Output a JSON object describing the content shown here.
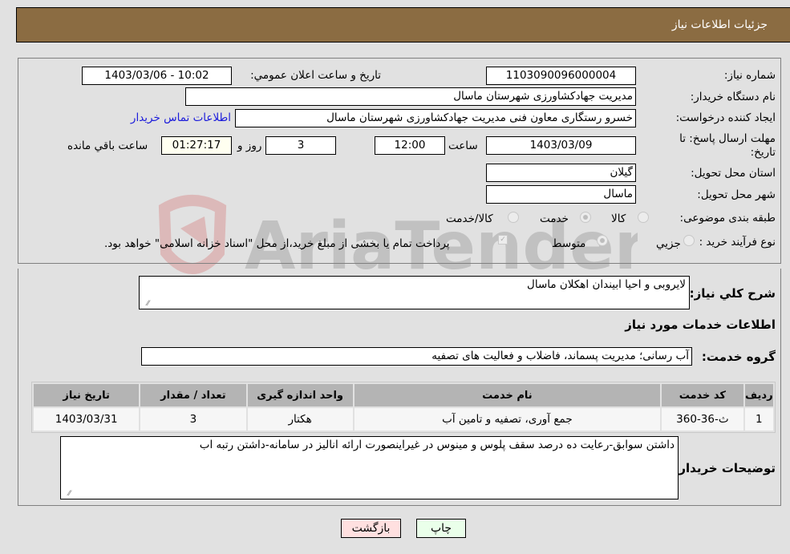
{
  "header": {
    "title": "جزئيات اطلاعات نياز"
  },
  "fields": {
    "need_number": {
      "label": "شماره نياز:",
      "value": "1103090096000004"
    },
    "announce_datetime": {
      "label": "تاريخ و ساعت اعلان عمومي:",
      "value": "1403/03/06 - 10:02"
    },
    "buyer_org": {
      "label": "نام دستگاه خريدار:",
      "value": "مديريت جهادکشاورزی شهرستان ماسال"
    },
    "requester": {
      "label": "ايجاد کننده درخواست:",
      "value": "خسرو  رستگاری معاون فنی مديريت جهادکشاورزی شهرستان ماسال"
    },
    "buyer_contact_link": "اطلاعات تماس خريدار",
    "deadline": {
      "label_line1": "مهلت ارسال پاسخ: تا",
      "label_line2": "تاريخ:",
      "date": "1403/03/09",
      "time_label": "ساعت",
      "time": "12:00",
      "days": "3",
      "days_label": "روز و",
      "remaining": "01:27:17",
      "remaining_label": "ساعت باقي مانده"
    },
    "province": {
      "label": "استان محل تحويل:",
      "value": "گيلان"
    },
    "city": {
      "label": "شهر محل تحويل:",
      "value": "ماسال"
    },
    "category": {
      "label": "طبقه بندی موضوعی:",
      "options": [
        "کالا",
        "خدمت",
        "کالا/خدمت"
      ],
      "selected": "خدمت"
    },
    "purchase_process": {
      "label": "نوع فرآيند خريد :",
      "options": [
        "جزيي",
        "متوسط"
      ],
      "selected": "متوسط",
      "payment_note": "پرداخت تمام يا بخشی از مبلغ خريد،از محل \"اسناد خزانه اسلامی\" خواهد بود."
    }
  },
  "summary": {
    "label": "شرح کلي نياز:",
    "value": "لايروبی و احيا ابيندان اهکلان ماسال"
  },
  "services_section": {
    "title": "اطلاعات خدمات مورد نياز",
    "group_label": "گروه خدمت:",
    "group_value": "آب رسانی؛ مديريت پسماند، فاضلاب و فعاليت های تصفيه"
  },
  "table": {
    "columns": [
      "رديف",
      "کد خدمت",
      "نام خدمت",
      "واحد اندازه گيری",
      "تعداد / مقدار",
      "تاريخ نياز"
    ],
    "rows": [
      [
        "1",
        "ث-36-360",
        "جمع آوری، تصفيه و تامين آب",
        "هکتار",
        "3",
        "1403/03/31"
      ]
    ]
  },
  "buyer_notes": {
    "label": "توضيحات خريدار:",
    "value": "داشتن سوابق-رعايت ده درصد سقف پلوس و مينوس در غيراينصورت ارائه انالیز در سامانه-داشتن رتبه اب"
  },
  "buttons": {
    "print": "چاپ",
    "back": "بازگشت"
  },
  "watermark": "AriaTender.neT",
  "colors": {
    "header_bg": "#8b6c42",
    "print_bg": "#eaffea",
    "back_bg": "#ffe0e0",
    "link": "#1a1adb"
  }
}
